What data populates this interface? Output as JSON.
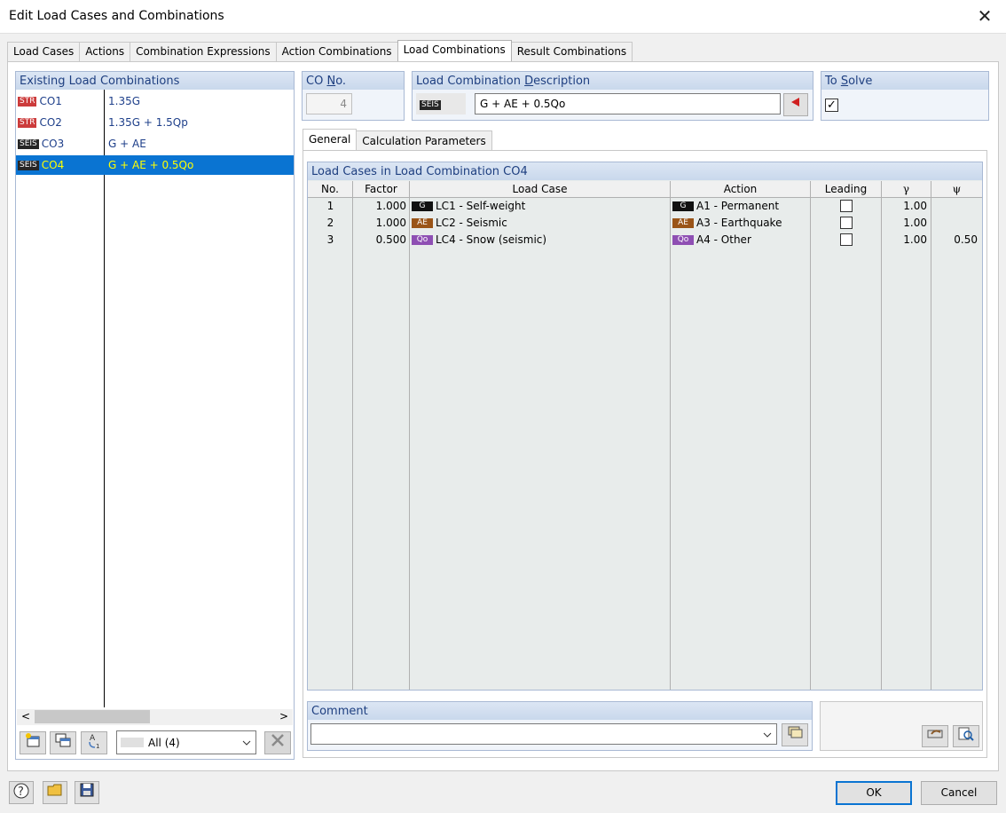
{
  "window": {
    "title": "Edit Load Cases and Combinations",
    "close_glyph": "✕"
  },
  "main_tabs": [
    "Load Cases",
    "Actions",
    "Combination Expressions",
    "Action Combinations",
    "Load Combinations",
    "Result Combinations"
  ],
  "active_main_tab": "Load Combinations",
  "left_panel": {
    "header": "Existing Load Combinations",
    "items": [
      {
        "badge": "STR",
        "code": "CO1",
        "desc": "1.35G"
      },
      {
        "badge": "STR",
        "code": "CO2",
        "desc": "1.35G + 1.5Qp"
      },
      {
        "badge": "SEIS",
        "code": "CO3",
        "desc": "G + AE"
      },
      {
        "badge": "SEIS",
        "code": "CO4",
        "desc": "G + AE + 0.5Qo"
      }
    ],
    "selected_index": 3,
    "filter_value": "All (4)",
    "scroll_left": "<",
    "scroll_right": ">"
  },
  "co_no": {
    "label_pre": "CO ",
    "label_u": "N",
    "label_post": "o.",
    "value": "4"
  },
  "description": {
    "label_pre": "Load Combination ",
    "label_u": "D",
    "label_post": "escription",
    "badge": "SEIS",
    "value": "G + AE + 0.5Qo"
  },
  "to_solve": {
    "label_pre": "To ",
    "label_u": "S",
    "label_post": "olve",
    "checked": true,
    "check_glyph": "✓"
  },
  "sub_tabs": [
    "General",
    "Calculation Parameters"
  ],
  "active_sub_tab": "General",
  "grid": {
    "title": "Load Cases in Load Combination CO4",
    "columns": [
      "No.",
      "Factor",
      "Load Case",
      "Action",
      "Leading",
      "γ",
      "ψ"
    ],
    "rows": [
      {
        "no": "1",
        "factor": "1.000",
        "lc_badge": "G",
        "load_case": "LC1 - Self-weight",
        "act_badge": "G",
        "action": "A1 - Permanent",
        "gamma": "1.00",
        "psi": ""
      },
      {
        "no": "2",
        "factor": "1.000",
        "lc_badge": "AE",
        "load_case": "LC2 - Seismic",
        "act_badge": "AE",
        "action": "A3 - Earthquake",
        "gamma": "1.00",
        "psi": ""
      },
      {
        "no": "3",
        "factor": "0.500",
        "lc_badge": "Qo",
        "load_case": "LC4 - Snow (seismic)",
        "act_badge": "Qo",
        "action": "A4 - Other",
        "gamma": "1.00",
        "psi": "0.50"
      }
    ]
  },
  "comment": {
    "label": "Comment",
    "value": ""
  },
  "buttons": {
    "ok": "OK",
    "cancel": "Cancel"
  },
  "colors": {
    "accent": "#0a74d2",
    "header_text": "#1e3f80",
    "selected_text": "#ffff00",
    "str_badge": "#cc3b3b",
    "seis_badge": "#262626",
    "ae_badge": "#9a5418",
    "qo_badge": "#8e4fb3"
  }
}
